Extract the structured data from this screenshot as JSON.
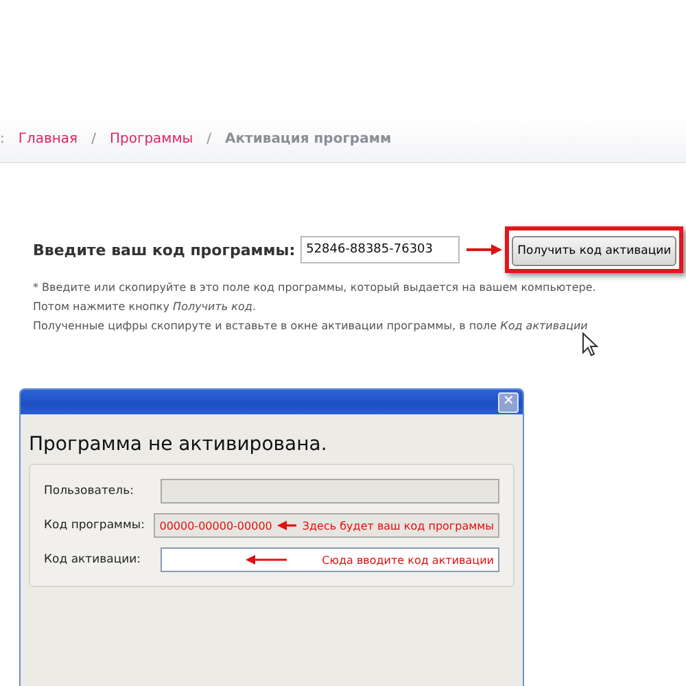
{
  "breadcrumb": [
    {
      "label": ":",
      "kind": "prefix"
    },
    {
      "label": "Главная",
      "kind": "link"
    },
    {
      "label": "/",
      "kind": "separator"
    },
    {
      "label": "Программы",
      "kind": "link"
    },
    {
      "label": "/",
      "kind": "separator"
    },
    {
      "label": "Активация программ",
      "kind": "current"
    }
  ],
  "code_form": {
    "label": "Введите ваш код программы:",
    "value": "52846-88385-76303",
    "button": "Получить код активации"
  },
  "notes": [
    {
      "text": "* Введите или скопируйте в это поле код программы, который выдается на вашем компьютере."
    },
    {
      "text": "Потом нажмите кнопку *Получить код*."
    },
    {
      "text": "Полученные цифры скопируте и вставьте в окне активации программы, в поле *Код активации*"
    }
  ],
  "dialog": {
    "close": "✕",
    "heading": "Программа не активирована.",
    "fields": [
      {
        "label": "Пользователь:",
        "kind": "disabled"
      },
      {
        "label": "Код программы:",
        "kind": "readonly",
        "value": "00000-00000-00000",
        "annotation": "Здесь будет ваш код программы"
      },
      {
        "label": "Код активации:",
        "kind": "input",
        "annotation": "Сюда вводите код активации"
      }
    ]
  }
}
